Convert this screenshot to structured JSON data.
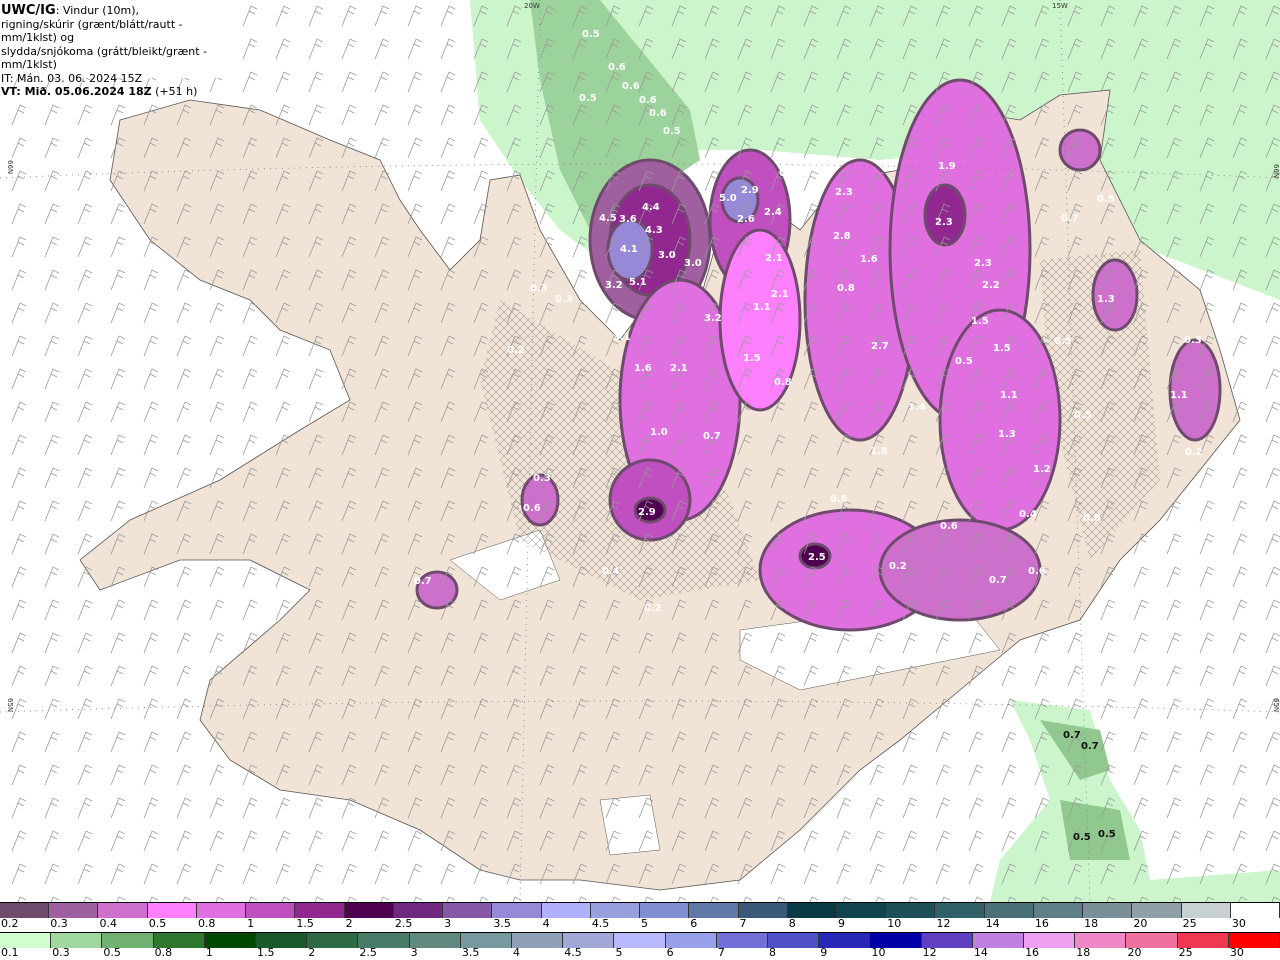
{
  "title": {
    "model": "UWC/IG",
    "line1": ": Vindur (10m),",
    "line2": "rigning/skúrir (grænt/blátt/rautt - mm/1klst) og",
    "line3": "slydda/snjókoma (grátt/bleikt/grænt - mm/1klst)",
    "init_time": "IT: Mán. 03. 06. 2024 15Z",
    "valid_time_bold": "VT: Mið. 05.06.2024 18Z",
    "lead": " (+51 h)"
  },
  "grid_labels": {
    "lon_20": "20W",
    "lon_15": "15W",
    "lat_66": "66N",
    "lat_65": "65N"
  },
  "colors": {
    "land": "#f1e3d6",
    "sea": "#ffffff",
    "rain_light": "#ccf5cc",
    "roads": "#e8703a",
    "wind_barb": "#888888"
  },
  "map_values_snow": [
    "0.5",
    "0.6",
    "0.5",
    "0.6",
    "0.6",
    "0.6",
    "0.5",
    "4.5",
    "3.6",
    "4.4",
    "4.3",
    "4.1",
    "3.0",
    "3.0",
    "3.2",
    "5.1",
    "5.0",
    "2.9",
    "2.6",
    "2.4",
    "2.1",
    "2.3",
    "2.8",
    "1.6",
    "1.9",
    "2.3",
    "2.3",
    "2.2",
    "1.5",
    "1.5",
    "0.5",
    "2.7",
    "1.4",
    "1.8",
    "1.1",
    "1.3",
    "1.2",
    "0.5",
    "0.5",
    "1.3",
    "0.7",
    "0.5",
    "0.3",
    "1.1",
    "0.2",
    "3.2",
    "3.1",
    "1.6",
    "2.1",
    "1.5",
    "0.8",
    "1.1",
    "2.1",
    "0.8",
    "1.0",
    "0.7",
    "2.9",
    "0.6",
    "0.6",
    "0.4",
    "0.8",
    "2.5",
    "0.2",
    "0.7",
    "0.6",
    "0.4",
    "0.2",
    "0.3",
    "0.6",
    "0.7",
    "0.3",
    "0.3",
    "0.2",
    "0.3",
    "0.8"
  ],
  "map_values_rain": [
    "0.7",
    "0.7",
    "0.5",
    "0.5"
  ],
  "legend_snow": {
    "labels": [
      "0.2",
      "0.3",
      "0.4",
      "0.5",
      "0.8",
      "1",
      "1.5",
      "2",
      "2.5",
      "3",
      "3.5",
      "4",
      "4.5",
      "5",
      "6",
      "7",
      "8",
      "9",
      "10",
      "12",
      "14",
      "16",
      "18",
      "20",
      "25",
      "30"
    ],
    "colors": [
      "#6e4a6c",
      "#a060a0",
      "#cc70cc",
      "#ff80ff",
      "#e070e0",
      "#c050c0",
      "#902890",
      "#500050",
      "#702880",
      "#8858a8",
      "#9888d8",
      "#b0b0ff",
      "#98a0e0",
      "#8090d0",
      "#6078a8",
      "#3a5878",
      "#0a3a48",
      "#104550",
      "#1e5058",
      "#306068",
      "#4a7078",
      "#608088",
      "#7a9098",
      "#90a0a8",
      "#c8d0d4",
      "#ffffff"
    ]
  },
  "legend_rain": {
    "labels": [
      "0.1",
      "0.3",
      "0.5",
      "0.8",
      "1",
      "1.5",
      "2",
      "2.5",
      "3",
      "3.5",
      "4",
      "4.5",
      "5",
      "6",
      "7",
      "8",
      "9",
      "10",
      "12",
      "14",
      "16",
      "18",
      "20",
      "25",
      "30"
    ],
    "colors": [
      "#d0ffd0",
      "#a0d8a0",
      "#70b070",
      "#307830",
      "#004800",
      "#1a5a2a",
      "#2e6a44",
      "#487a68",
      "#608a80",
      "#7898a0",
      "#90a0b8",
      "#a0a8d8",
      "#b8b8ff",
      "#98a0e8",
      "#7070d8",
      "#5050c8",
      "#2828b8",
      "#0000a8",
      "#6040c0",
      "#c080e0",
      "#f0a0f0",
      "#f088c8",
      "#f070a0",
      "#f03850",
      "#ff0000"
    ]
  }
}
